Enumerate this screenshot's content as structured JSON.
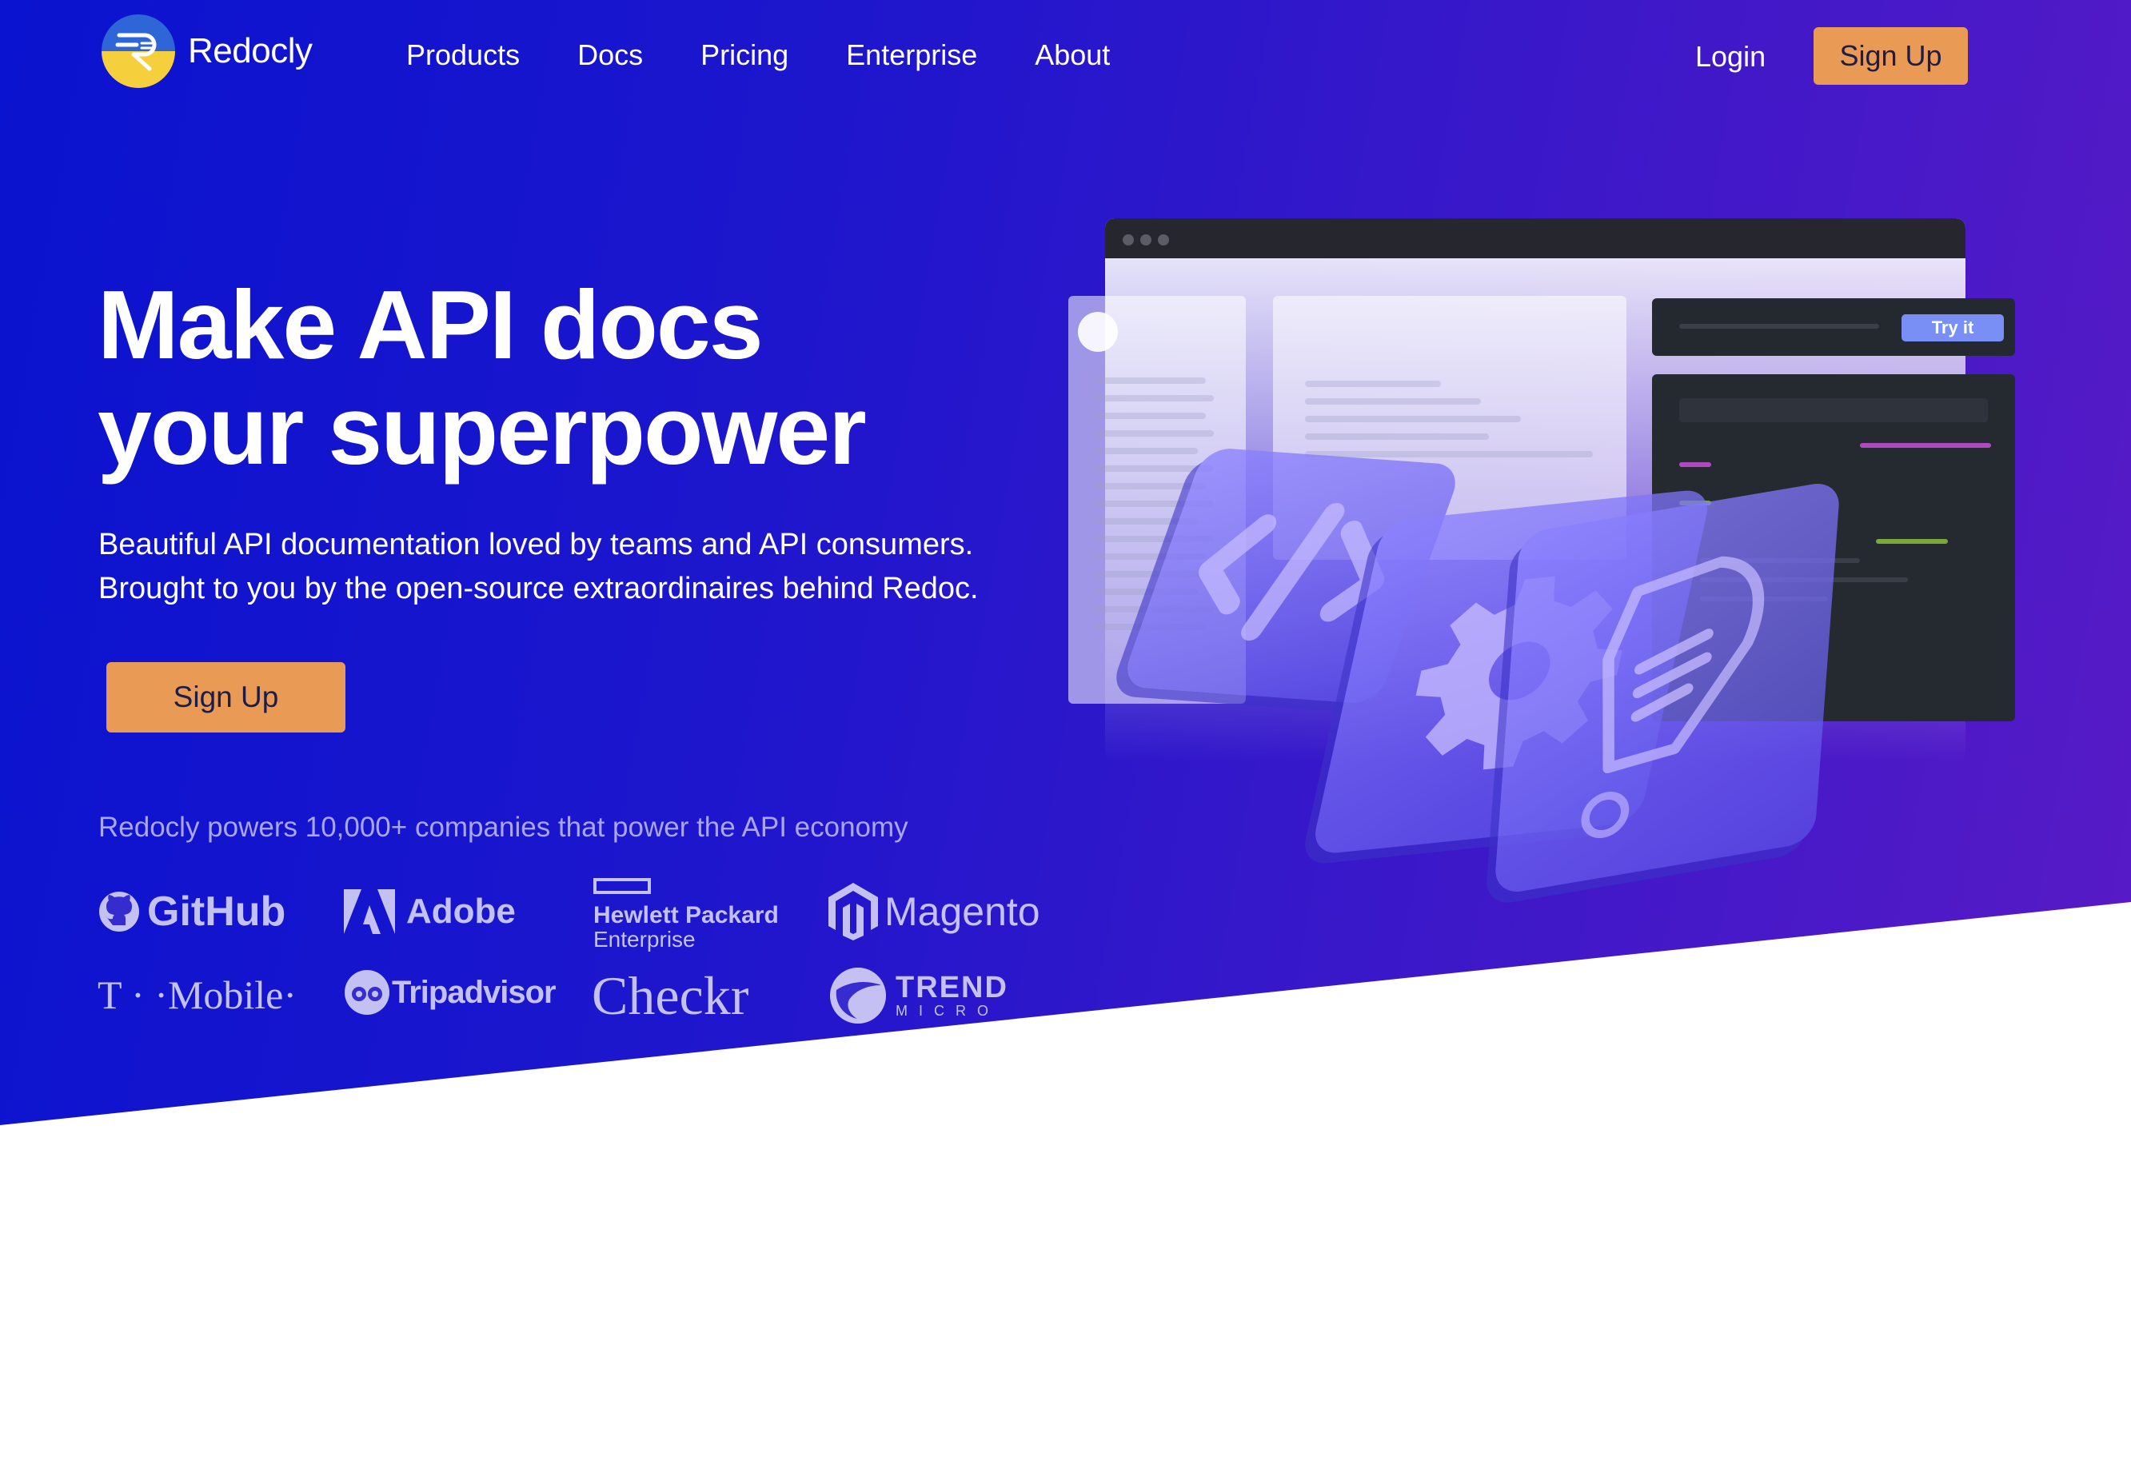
{
  "brand": {
    "name": "Redocly"
  },
  "nav": {
    "links": [
      "Products",
      "Docs",
      "Pricing",
      "Enterprise",
      "About"
    ],
    "login": "Login",
    "signup": "Sign Up"
  },
  "hero": {
    "headline_line1": "Make API docs",
    "headline_line2": "your superpower",
    "sub_line1": "Beautiful API documentation loved by teams and API consumers.",
    "sub_line2": "Brought to you by the open-source extraordinaires behind Redoc.",
    "cta": "Sign Up",
    "powers": "Redocly powers 10,000+ companies that power the API economy"
  },
  "companies": [
    {
      "name": "GitHub"
    },
    {
      "name": "Adobe"
    },
    {
      "name": "Hewlett Packard",
      "sub": "Enterprise"
    },
    {
      "name": "Magento"
    },
    {
      "name": "T · ·Mobile·"
    },
    {
      "name": "Tripadvisor"
    },
    {
      "name": "Checkr"
    },
    {
      "name": "TREND",
      "sub": "MICRO"
    }
  ],
  "illustration": {
    "try_it": "Try it"
  },
  "colors": {
    "accent": "#e99a54",
    "hero_start": "#0a13cf",
    "hero_end": "#5a1ac6",
    "muted_text": "#a9a6ee"
  }
}
